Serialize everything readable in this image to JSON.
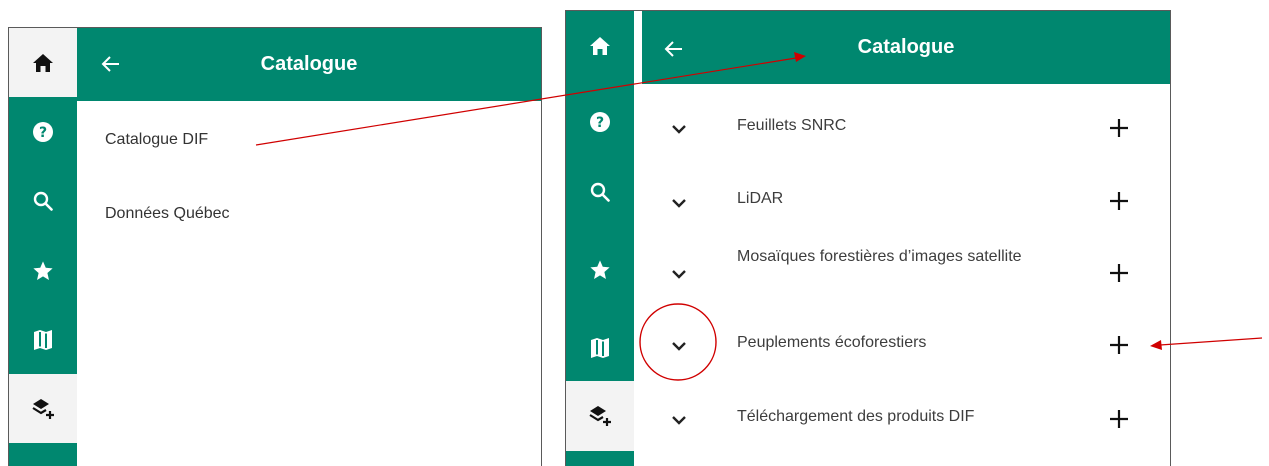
{
  "icons": {
    "rail": [
      "home-icon",
      "help-icon",
      "search-icon",
      "star-icon",
      "map-icon",
      "layers-add-icon"
    ],
    "back": "arrow-left-icon",
    "expand": "chevron-down-icon",
    "add": "plus-icon"
  },
  "colors": {
    "accent": "#00876f",
    "annotation": "#d00000"
  },
  "left_panel": {
    "title": "Catalogue",
    "items": [
      "Catalogue DIF",
      "Données Québec"
    ]
  },
  "right_panel": {
    "title": "Catalogue",
    "rows": [
      {
        "label": "Feuillets SNRC"
      },
      {
        "label": "LiDAR"
      },
      {
        "label": "Mosaïques forestières d’images satellite"
      },
      {
        "label": "Peuplements écoforestiers"
      },
      {
        "label": "Téléchargement des produits DIF"
      }
    ]
  }
}
